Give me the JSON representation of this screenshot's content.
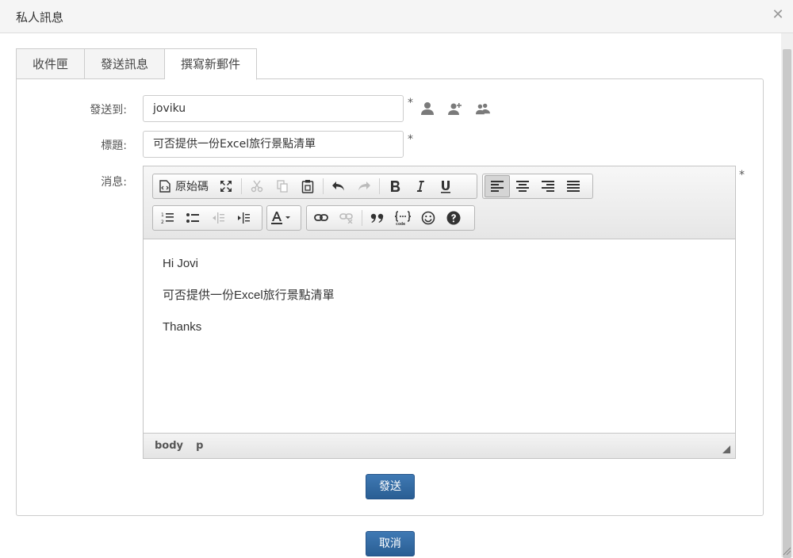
{
  "window": {
    "title": "私人訊息"
  },
  "tabs": [
    {
      "label": "收件匣"
    },
    {
      "label": "發送訊息"
    },
    {
      "label": "撰寫新郵件"
    }
  ],
  "form": {
    "to_label": "發送到:",
    "to_value": "joviku",
    "subject_label": "標題:",
    "subject_value": "可否提供一份Excel旅行景點清單",
    "message_label": "消息:",
    "required_mark": "*"
  },
  "editor": {
    "source_label": "原始碼",
    "content": [
      "Hi Jovi",
      "可否提供一份Excel旅行景點清單",
      "Thanks"
    ],
    "path": [
      "body",
      "p"
    ]
  },
  "buttons": {
    "send": "發送",
    "cancel": "取消"
  },
  "colors": {
    "primary": "#2f69a3",
    "border": "#cccccc"
  }
}
